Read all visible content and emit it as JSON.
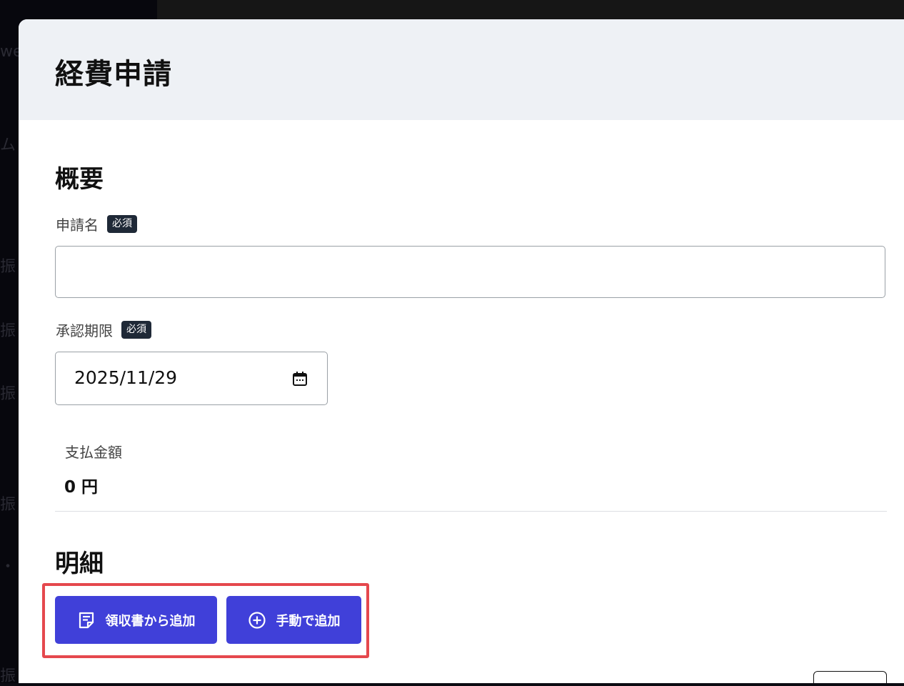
{
  "background": {
    "fragments": [
      "we",
      "ム",
      "振",
      "振",
      "振",
      "振",
      "・・",
      "振"
    ]
  },
  "modal": {
    "title": "経費申請"
  },
  "overview": {
    "section_title": "概要",
    "application_name": {
      "label": "申請名",
      "required_badge": "必須",
      "value": "",
      "placeholder": ""
    },
    "approval_deadline": {
      "label": "承認期限",
      "required_badge": "必須",
      "value": "2025/11/29"
    },
    "payment_amount": {
      "label": "支払金額",
      "value": "0 円"
    }
  },
  "details": {
    "section_title": "明細",
    "add_from_receipt_label": "領収書から追加",
    "add_manually_label": "手動で追加"
  },
  "colors": {
    "primary": "#4040d9",
    "highlight": "#e5484d",
    "header_bg": "#eef1f5",
    "badge_bg": "#1f2937"
  }
}
